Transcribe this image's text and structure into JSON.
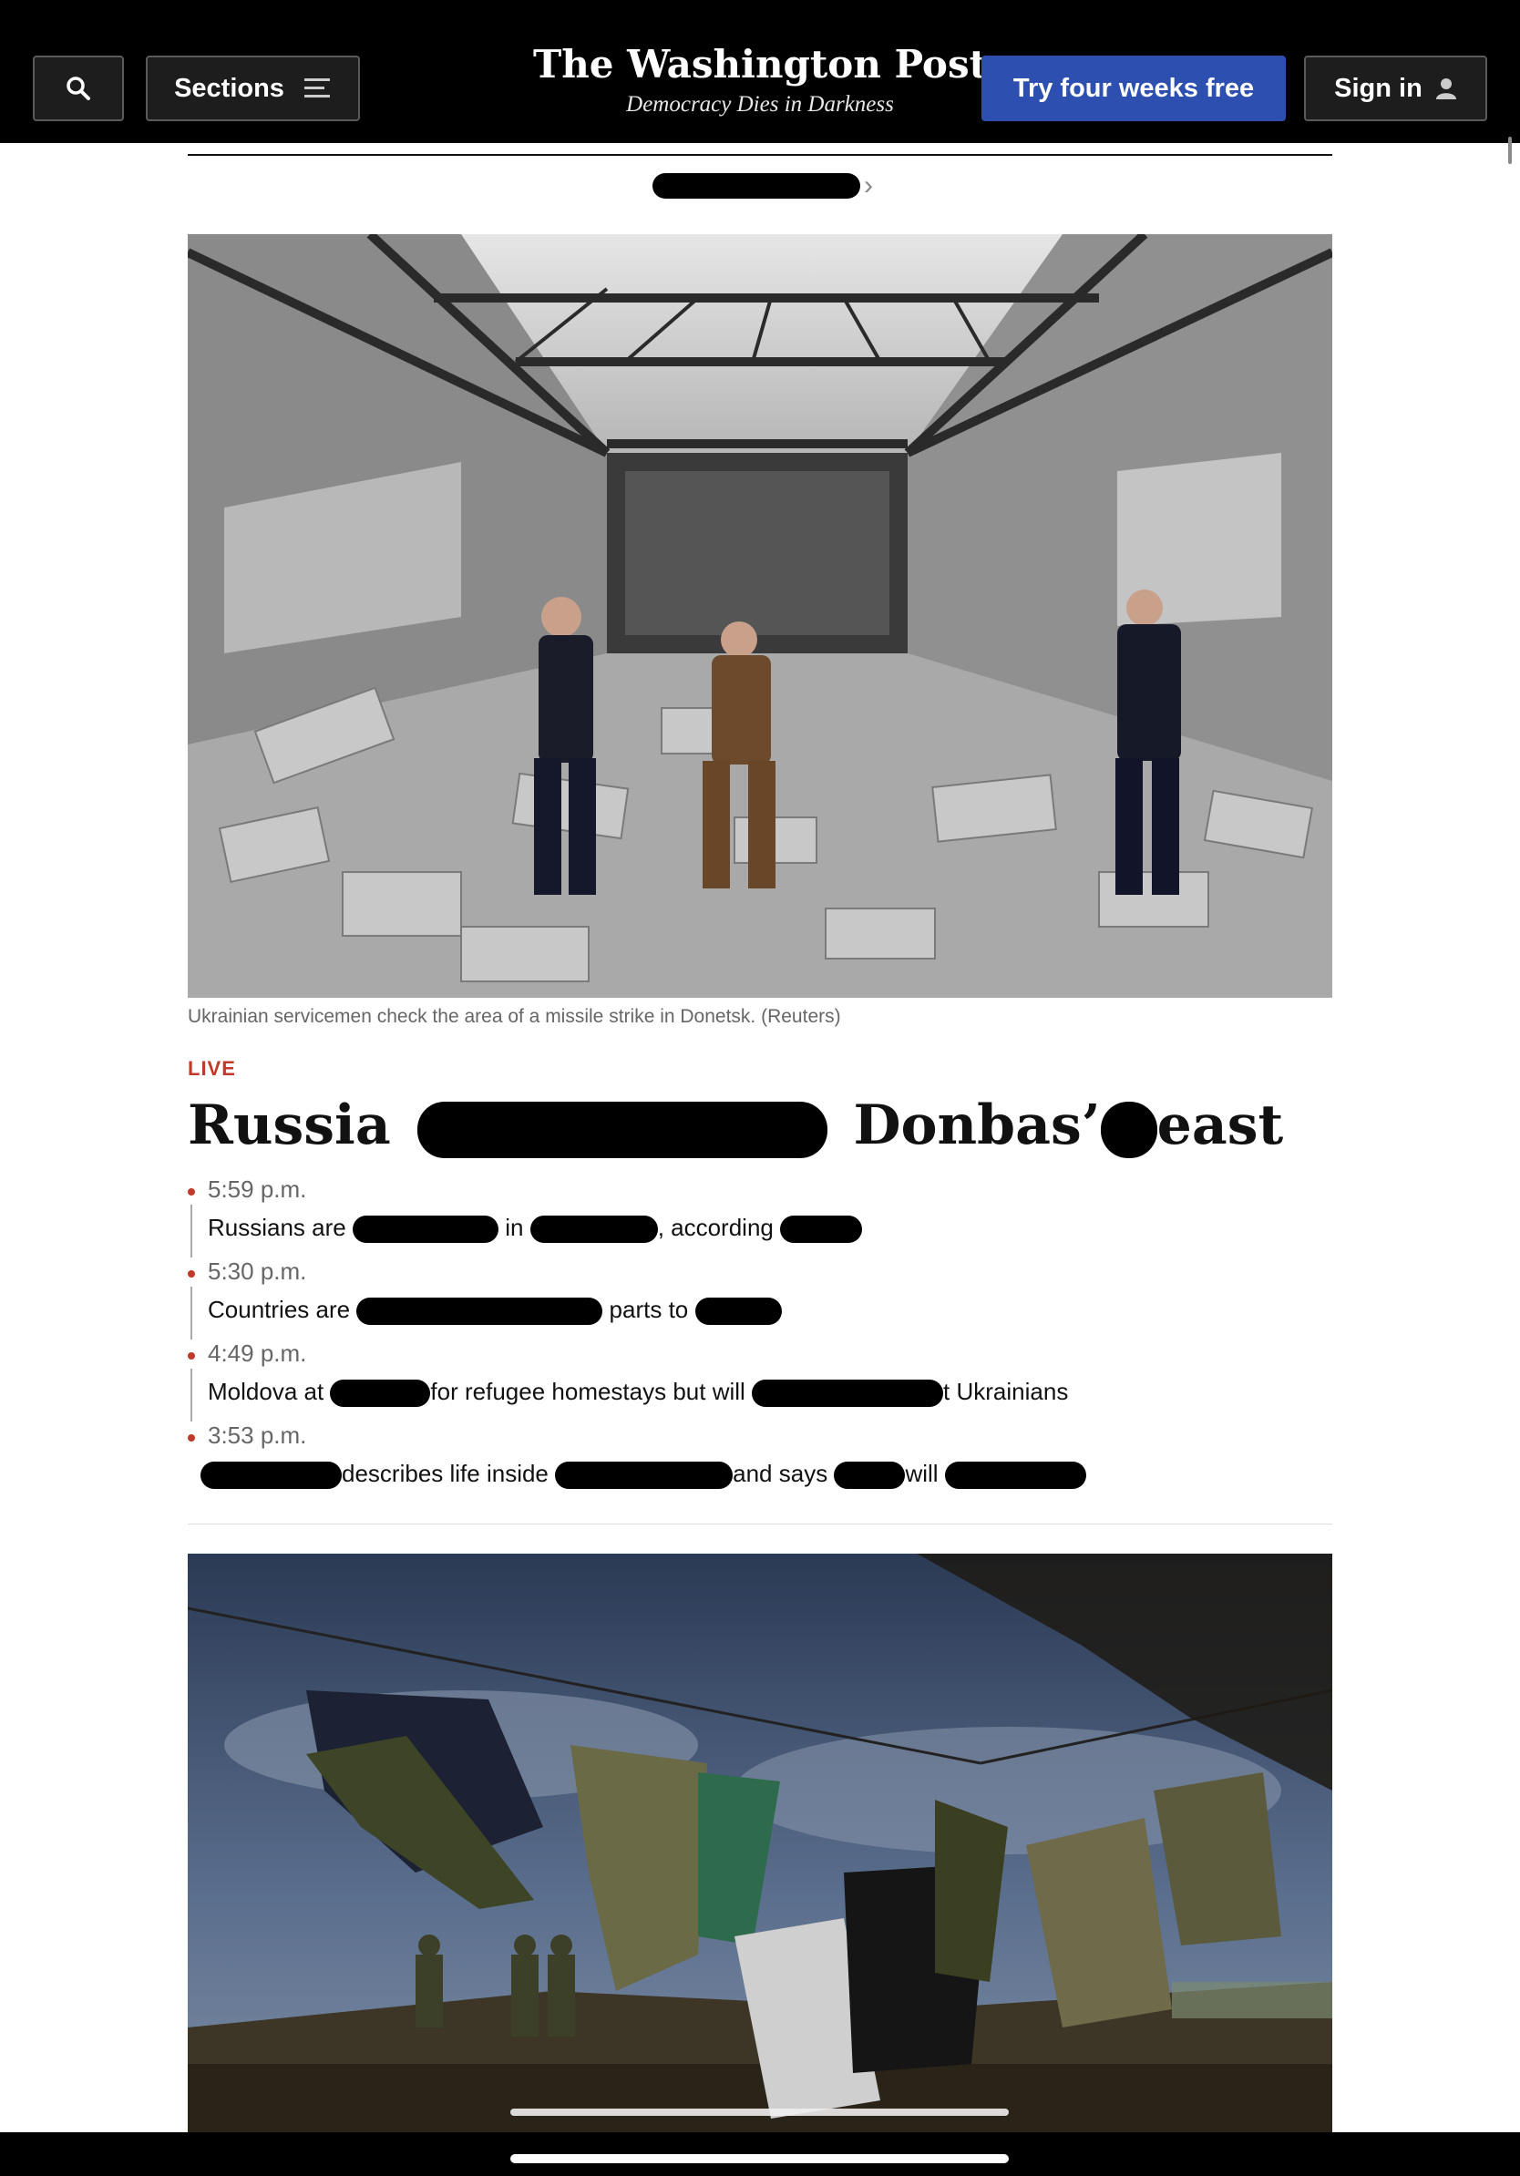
{
  "header": {
    "sections_label": "Sections",
    "logo": "The Washington Post",
    "tagline": "Democracy Dies in Darkness",
    "subscribe_label": "Try four weeks free",
    "signin_label": "Sign in"
  },
  "icons": {
    "search": "search-icon",
    "menu": "hamburger-icon",
    "user": "user-icon"
  },
  "article": {
    "caption": "Ukrainian servicemen check the area of a missile strike in Donetsk. (Reuters)",
    "live_label": "LIVE",
    "headline": {
      "part1": "Russia",
      "part2": "Donbas’",
      "part3": "east"
    },
    "updates": [
      {
        "time": "5:59 p.m.",
        "segments": [
          "Russians are",
          "in",
          ", according"
        ]
      },
      {
        "time": "5:30 p.m.",
        "segments": [
          "Countries are",
          "parts to"
        ]
      },
      {
        "time": "4:49 p.m.",
        "segments": [
          "Moldova at",
          "for refugee homestays but will",
          "t Ukrainians"
        ]
      },
      {
        "time": "3:53 p.m.",
        "segments": [
          "describes life inside",
          "and says",
          "will"
        ]
      }
    ]
  },
  "colors": {
    "header_bg": "#000000",
    "subscribe_bg": "#2c4fb0",
    "live_red": "#c0392b"
  }
}
